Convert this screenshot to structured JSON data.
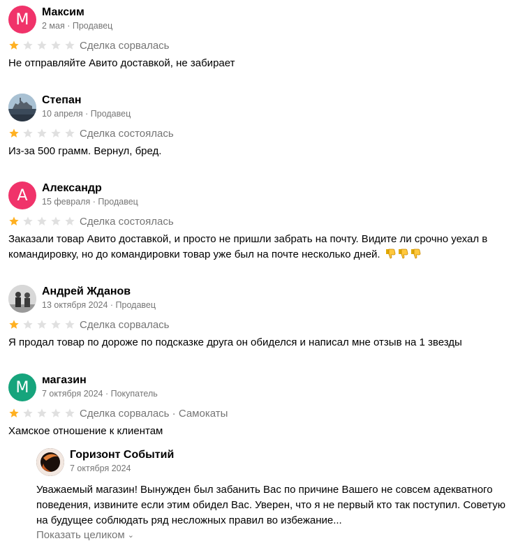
{
  "colors": {
    "star_filled": "#FFB021",
    "star_empty": "#E0E0E0",
    "muted": "#757575",
    "avatar_pink": "#F0336A",
    "avatar_teal": "#16A47C"
  },
  "reviews": [
    {
      "name": "Максим",
      "avatar_letter": "М",
      "meta": "2 мая · Продавец",
      "rating": 1,
      "status": "Сделка сорвалась",
      "text": "Не отправляйте Авито доставкой, не забирает"
    },
    {
      "name": "Степан",
      "avatar_letter": "",
      "meta": "10 апреля · Продавец",
      "rating": 1,
      "status": "Сделка состоялась",
      "text": "Из-за 500 грамм. Вернул, бред."
    },
    {
      "name": "Александр",
      "avatar_letter": "А",
      "meta": "15 февраля · Продавец",
      "rating": 1,
      "status": "Сделка состоялась",
      "text": "Заказали товар Авито доставкой, и просто не пришли забрать на почту. Видите ли срочно уехал в командировку, но до командировки товар уже был на почте несколько дней.",
      "emoji": "thumbs-down-icon x3"
    },
    {
      "name": "Андрей Жданов",
      "avatar_letter": "",
      "meta": "13 октября 2024 · Продавец",
      "rating": 1,
      "status": "Сделка сорвалась",
      "text": "Я продал товар по дороже по подсказке друга он обиделся и написал мне отзыв на 1 звезды"
    },
    {
      "name": "магазин",
      "avatar_letter": "М",
      "meta": "7 октября 2024 · Покупатель",
      "rating": 1,
      "status": "Сделка сорвалась · Самокаты",
      "text": "Хамское отношение к клиентам"
    }
  ],
  "reply": {
    "name": "Горизонт Событий",
    "meta": "7 октября 2024",
    "text": "Уважаемый магазин! Вынужден был забанить Вас по причине Вашего не совсем адекватного поведения, извините если этим обидел Вас. Уверен, что я не первый кто так поступил. Советую на будущее соблюдать ряд несложных правил во избежание...",
    "show_more": "Показать целиком"
  }
}
